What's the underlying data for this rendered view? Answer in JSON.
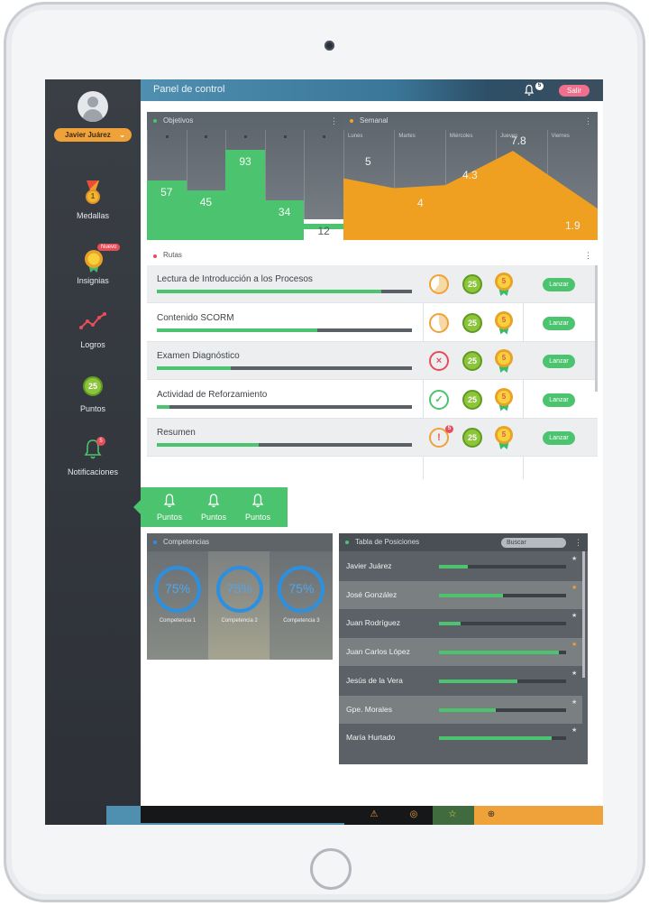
{
  "user": {
    "name": "Javier Juárez"
  },
  "sidebar": {
    "items": [
      {
        "label": "Medallas",
        "medal_value": "1"
      },
      {
        "label": "Insignias",
        "badge": "Nuevo"
      },
      {
        "label": "Logros"
      },
      {
        "label": "Puntos",
        "value": "25"
      },
      {
        "label": "Notificaciones",
        "count": "5"
      }
    ]
  },
  "topbar": {
    "title": "Panel de control",
    "notif_count": "5",
    "exit_label": "Salir"
  },
  "objetivos": {
    "title": "Objetivos"
  },
  "semanal": {
    "title": "Semanal",
    "days": [
      "Lunes",
      "Martes",
      "Miércoles",
      "Jueves",
      "Viernes"
    ]
  },
  "chart_data": [
    {
      "type": "bar",
      "values": [
        57,
        45,
        93,
        34,
        12
      ],
      "highlight_index": 4,
      "bar_color": "#4cc36f",
      "highlight_color": "#ffffff"
    },
    {
      "type": "area",
      "x": [
        "Lunes",
        "Martes",
        "Miércoles",
        "Jueves",
        "Viernes"
      ],
      "values": [
        5,
        4,
        4.3,
        7.8,
        1.9
      ],
      "color": "#f0a021"
    }
  ],
  "rutas": {
    "title": "Rutas",
    "action_label": "Lanzar",
    "points_label": "25",
    "ribbon_label": "5",
    "rows": [
      {
        "name": "Lectura de Introducción a los Procesos",
        "progress": 0.88,
        "status": "partial"
      },
      {
        "name": "Contenido SCORM",
        "progress": 0.63,
        "status": "partial"
      },
      {
        "name": "Examen Diagnóstico",
        "progress": 0.29,
        "status": "failed"
      },
      {
        "name": "Actividad de Reforzamiento",
        "progress": 0.05,
        "status": "done"
      },
      {
        "name": "Resumen",
        "progress": 0.4,
        "status": "pending",
        "alert_count": "5"
      }
    ]
  },
  "puntos_tab": {
    "items": [
      "Puntos",
      "Puntos",
      "Puntos"
    ]
  },
  "competencias": {
    "title": "Competencias",
    "items": [
      {
        "label": "Competencia 1",
        "value": "75%"
      },
      {
        "label": "Competencia 2",
        "value": "75%"
      },
      {
        "label": "Competencia 3",
        "value": "75%"
      }
    ]
  },
  "posiciones": {
    "title": "Tabla de Posiciones",
    "search_placeholder": "Buscar",
    "rows": [
      {
        "name": "Javier Juárez",
        "progress": 0.23,
        "star": "silver"
      },
      {
        "name": "José González",
        "progress": 0.5,
        "star": "gold"
      },
      {
        "name": "Juan Rodríguez",
        "progress": 0.17,
        "star": "silver"
      },
      {
        "name": "Juan Carlos López",
        "progress": 0.94,
        "star": "gold"
      },
      {
        "name": "Jesús de la Vera",
        "progress": 0.62,
        "star": "silver"
      },
      {
        "name": "Gpe. Morales",
        "progress": 0.45,
        "star": "silver"
      },
      {
        "name": "María Hurtado",
        "progress": 0.89,
        "star": "silver"
      }
    ]
  },
  "colors": {
    "accent_green": "#4cc36f",
    "accent_orange": "#f0a23a",
    "topbar_blue": "#4f8fb0",
    "alert_red": "#e94d5a"
  }
}
